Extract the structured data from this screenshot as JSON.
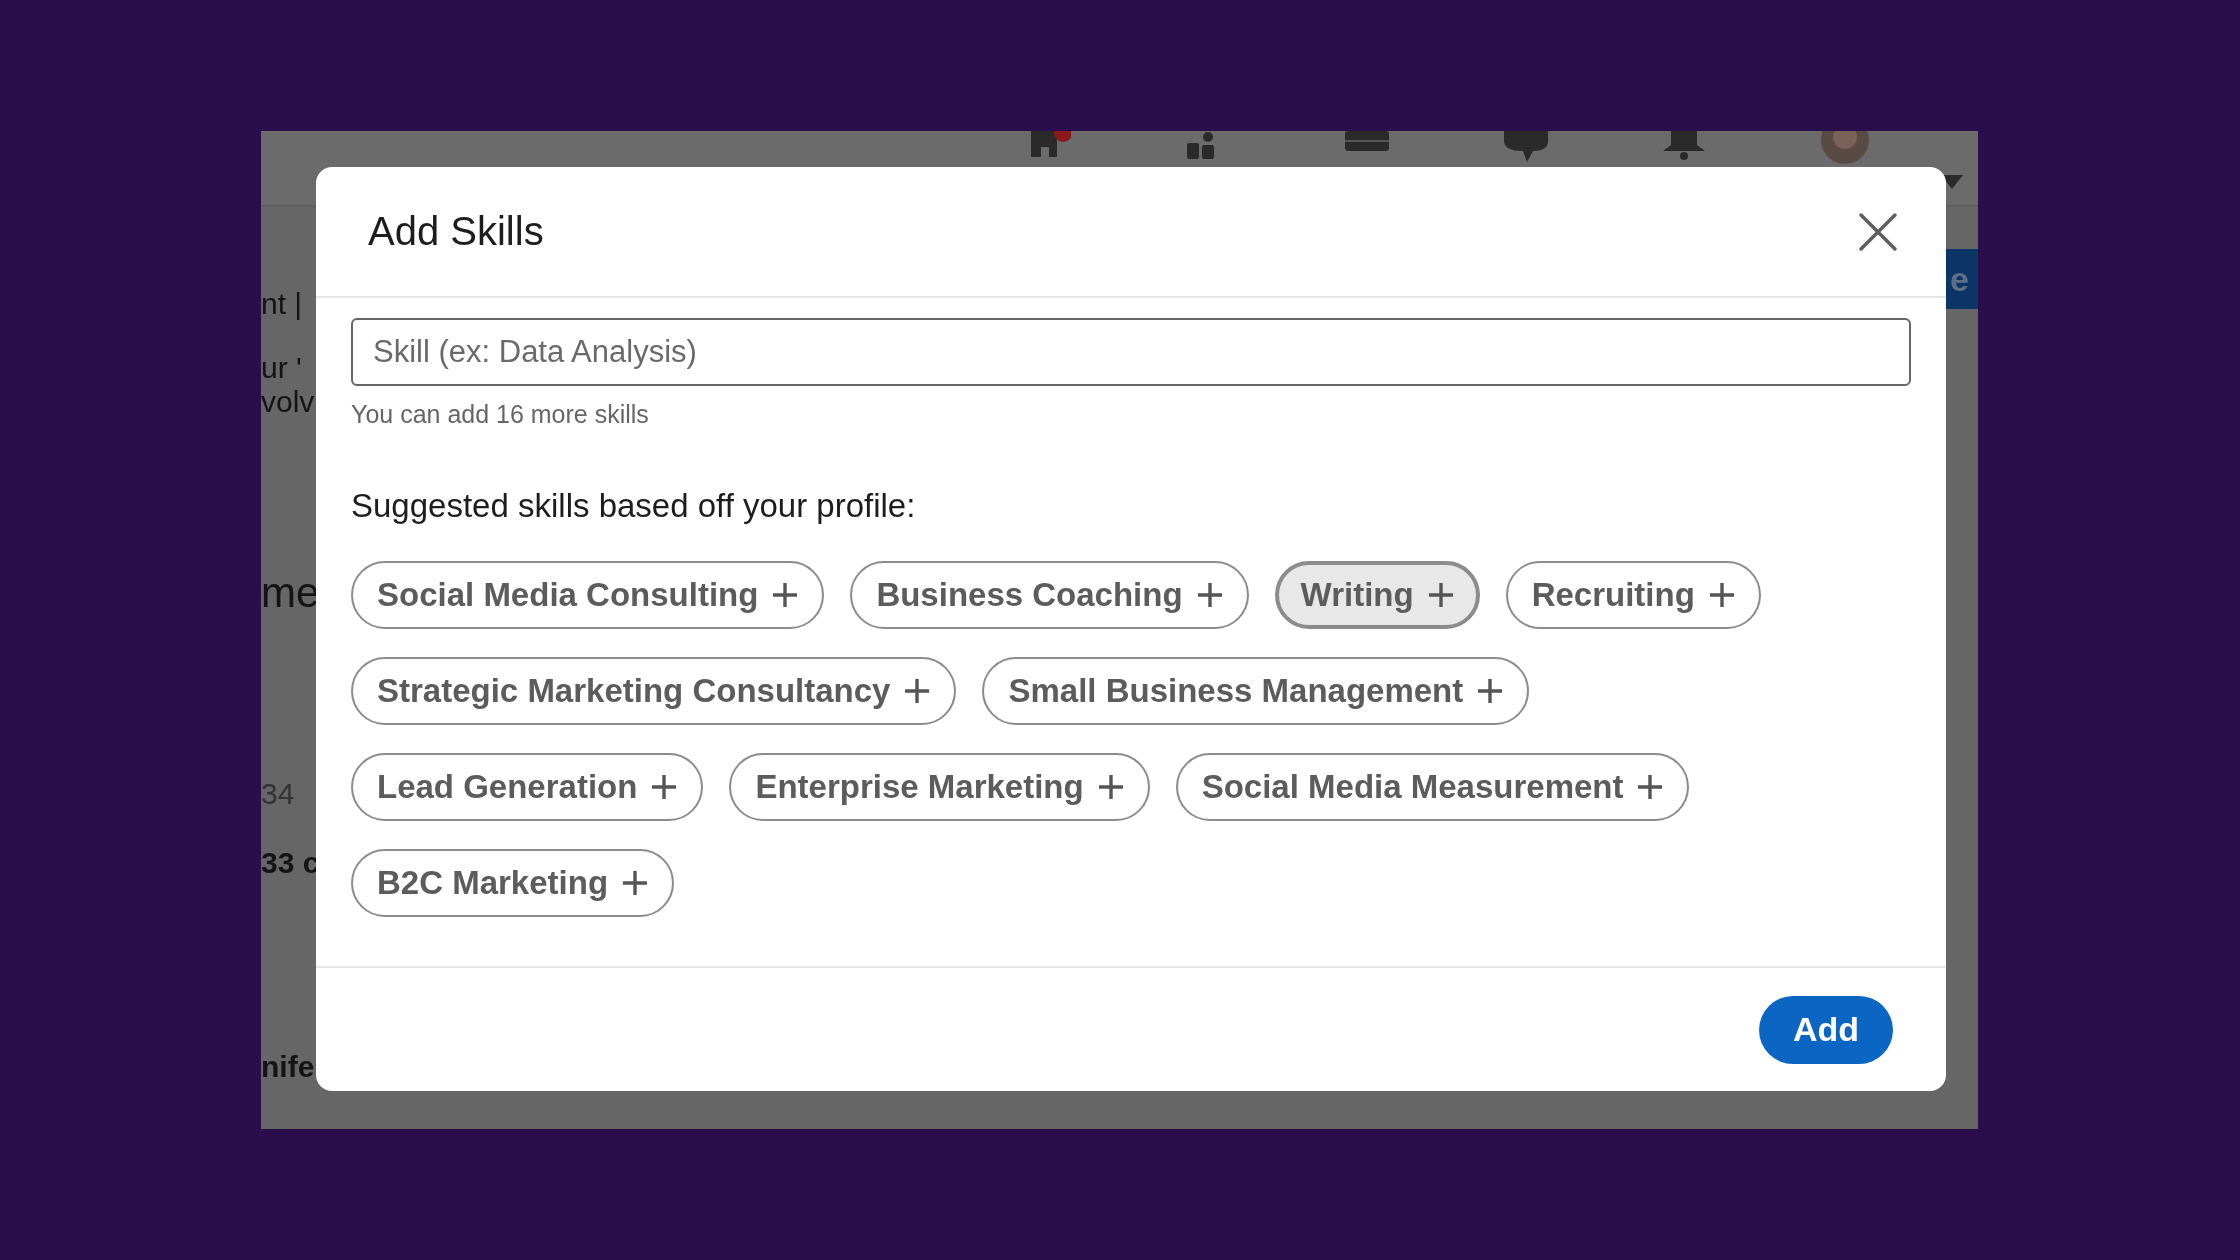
{
  "background_page": {
    "nav_icons": [
      {
        "kind": "home",
        "badge": true
      },
      {
        "kind": "people",
        "badge": false
      },
      {
        "kind": "briefcase",
        "badge": false
      },
      {
        "kind": "chat",
        "badge": false
      },
      {
        "kind": "bell",
        "badge": false
      },
      {
        "kind": "avatar",
        "badge": false
      }
    ],
    "fragments": [
      {
        "text": "nt |",
        "kind": "plain"
      },
      {
        "text": "ur '",
        "kind": "plain"
      },
      {
        "text": "volv",
        "kind": "plain"
      },
      {
        "text": "me",
        "kind": "heading"
      },
      {
        "text": "34",
        "kind": "muted"
      },
      {
        "text": "33 c",
        "kind": "bold"
      },
      {
        "text": "nife",
        "kind": "bold"
      }
    ],
    "button_text": "e"
  },
  "dialog": {
    "title": "Add Skills",
    "search": {
      "placeholder": "Skill (ex: Data Analysis)"
    },
    "helper_text": "You can add 16 more skills",
    "suggestions_heading": "Suggested skills based off your profile:",
    "skill_rows": [
      [
        {
          "label": "Social Media Consulting",
          "selected": false
        },
        {
          "label": "Business Coaching",
          "selected": false
        },
        {
          "label": "Writing",
          "selected": true
        },
        {
          "label": "Recruiting",
          "selected": false
        }
      ],
      [
        {
          "label": "Strategic Marketing Consultancy",
          "selected": false
        },
        {
          "label": "Small Business Management",
          "selected": false
        }
      ],
      [
        {
          "label": "Lead Generation",
          "selected": false
        },
        {
          "label": "Enterprise Marketing",
          "selected": false
        },
        {
          "label": "Social Media Measurement",
          "selected": false
        }
      ],
      [
        {
          "label": "B2C Marketing",
          "selected": false
        }
      ]
    ],
    "add_button": "Add"
  }
}
